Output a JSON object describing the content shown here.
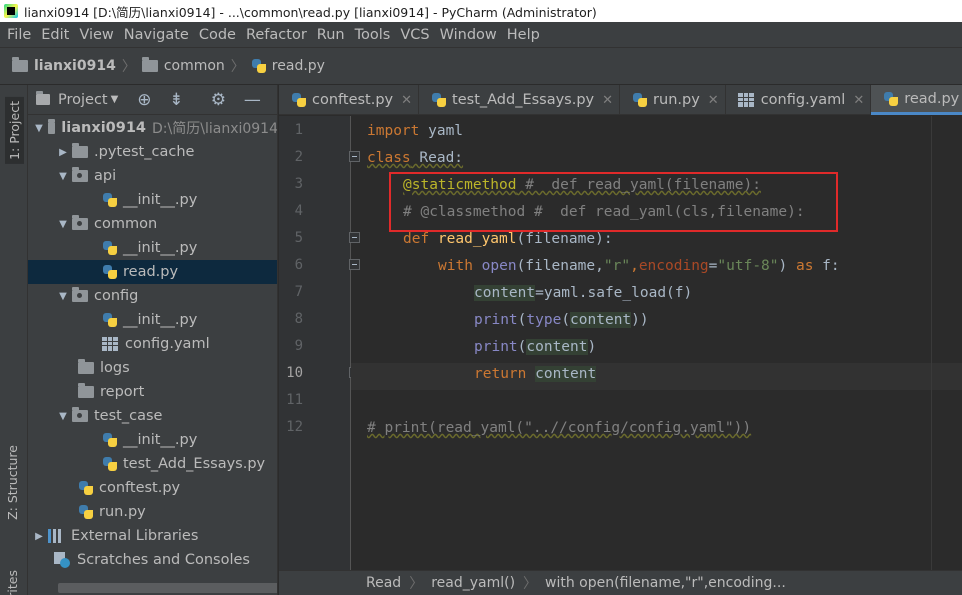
{
  "window": {
    "title": "lianxi0914 [D:\\简历\\lianxi0914] - ...\\common\\read.py [lianxi0914] - PyCharm (Administrator)"
  },
  "menu": [
    "File",
    "Edit",
    "View",
    "Navigate",
    "Code",
    "Refactor",
    "Run",
    "Tools",
    "VCS",
    "Window",
    "Help"
  ],
  "breadcrumb": {
    "project": "lianxi0914",
    "folder": "common",
    "file": "read.py"
  },
  "sidebar_tabs": {
    "project": "1: Project",
    "structure": "Z: Structure",
    "favorites": "rites"
  },
  "project_panel": {
    "title": "Project",
    "root_name": "lianxi0914",
    "root_path": "D:\\简历\\lianxi0914",
    "items": [
      {
        "label": ".pytest_cache"
      },
      {
        "label": "api"
      },
      {
        "label": "__init__.py"
      },
      {
        "label": "common"
      },
      {
        "label": "__init__.py"
      },
      {
        "label": "read.py"
      },
      {
        "label": "config"
      },
      {
        "label": "__init__.py"
      },
      {
        "label": "config.yaml"
      },
      {
        "label": "logs"
      },
      {
        "label": "report"
      },
      {
        "label": "test_case"
      },
      {
        "label": "__init__.py"
      },
      {
        "label": "test_Add_Essays.py"
      },
      {
        "label": "conftest.py"
      },
      {
        "label": "run.py"
      },
      {
        "label": "External Libraries"
      },
      {
        "label": "Scratches and Consoles"
      }
    ]
  },
  "tabs": [
    {
      "label": "conftest.py"
    },
    {
      "label": "test_Add_Essays.py"
    },
    {
      "label": "run.py"
    },
    {
      "label": "config.yaml"
    },
    {
      "label": "read.py"
    }
  ],
  "editor": {
    "line_numbers": [
      "1",
      "2",
      "3",
      "4",
      "5",
      "6",
      "7",
      "8",
      "9",
      "10",
      "11",
      "12"
    ],
    "current_line": "10",
    "code": {
      "l1_kw": "import",
      "l1_mod": " yaml",
      "l2_kw": "class",
      "l2_name": " Read:",
      "l3_dec": "@staticmethod",
      "l3_cm": " #  def read_yaml(filename):",
      "l4_cm": "# @classmethod #  def read_yaml(cls,filename):",
      "l5_kw": "def",
      "l5_fn": " read_yaml",
      "l5_rest": "(filename):",
      "l6_kw": "with",
      "l6_bi": " open",
      "l6_a": "(filename,",
      "l6_s1": "\"r\"",
      "l6_b": ",",
      "l6_pm": "encoding",
      "l6_c": "=",
      "l6_s2": "\"utf-8\"",
      "l6_d": ") ",
      "l6_kw2": "as",
      "l6_e": " f:",
      "l7_hl": "content",
      "l7_rest": "=yaml.safe_load(f)",
      "l8_bi": "print",
      "l8_a": "(",
      "l8_bi2": "type",
      "l8_b": "(",
      "l8_hl": "content",
      "l8_c": "))",
      "l9_bi": "print",
      "l9_a": "(",
      "l9_hl": "content",
      "l9_b": ")",
      "l10_kw": "return",
      "l10_sp": " ",
      "l10_hl": "content",
      "l12_cm": "# print(read_yaml(\"..//config/config.yaml\"))"
    }
  },
  "status_breadcrumb": [
    "Read",
    "read_yaml()",
    "with open(filename,\"r\",encoding..."
  ]
}
